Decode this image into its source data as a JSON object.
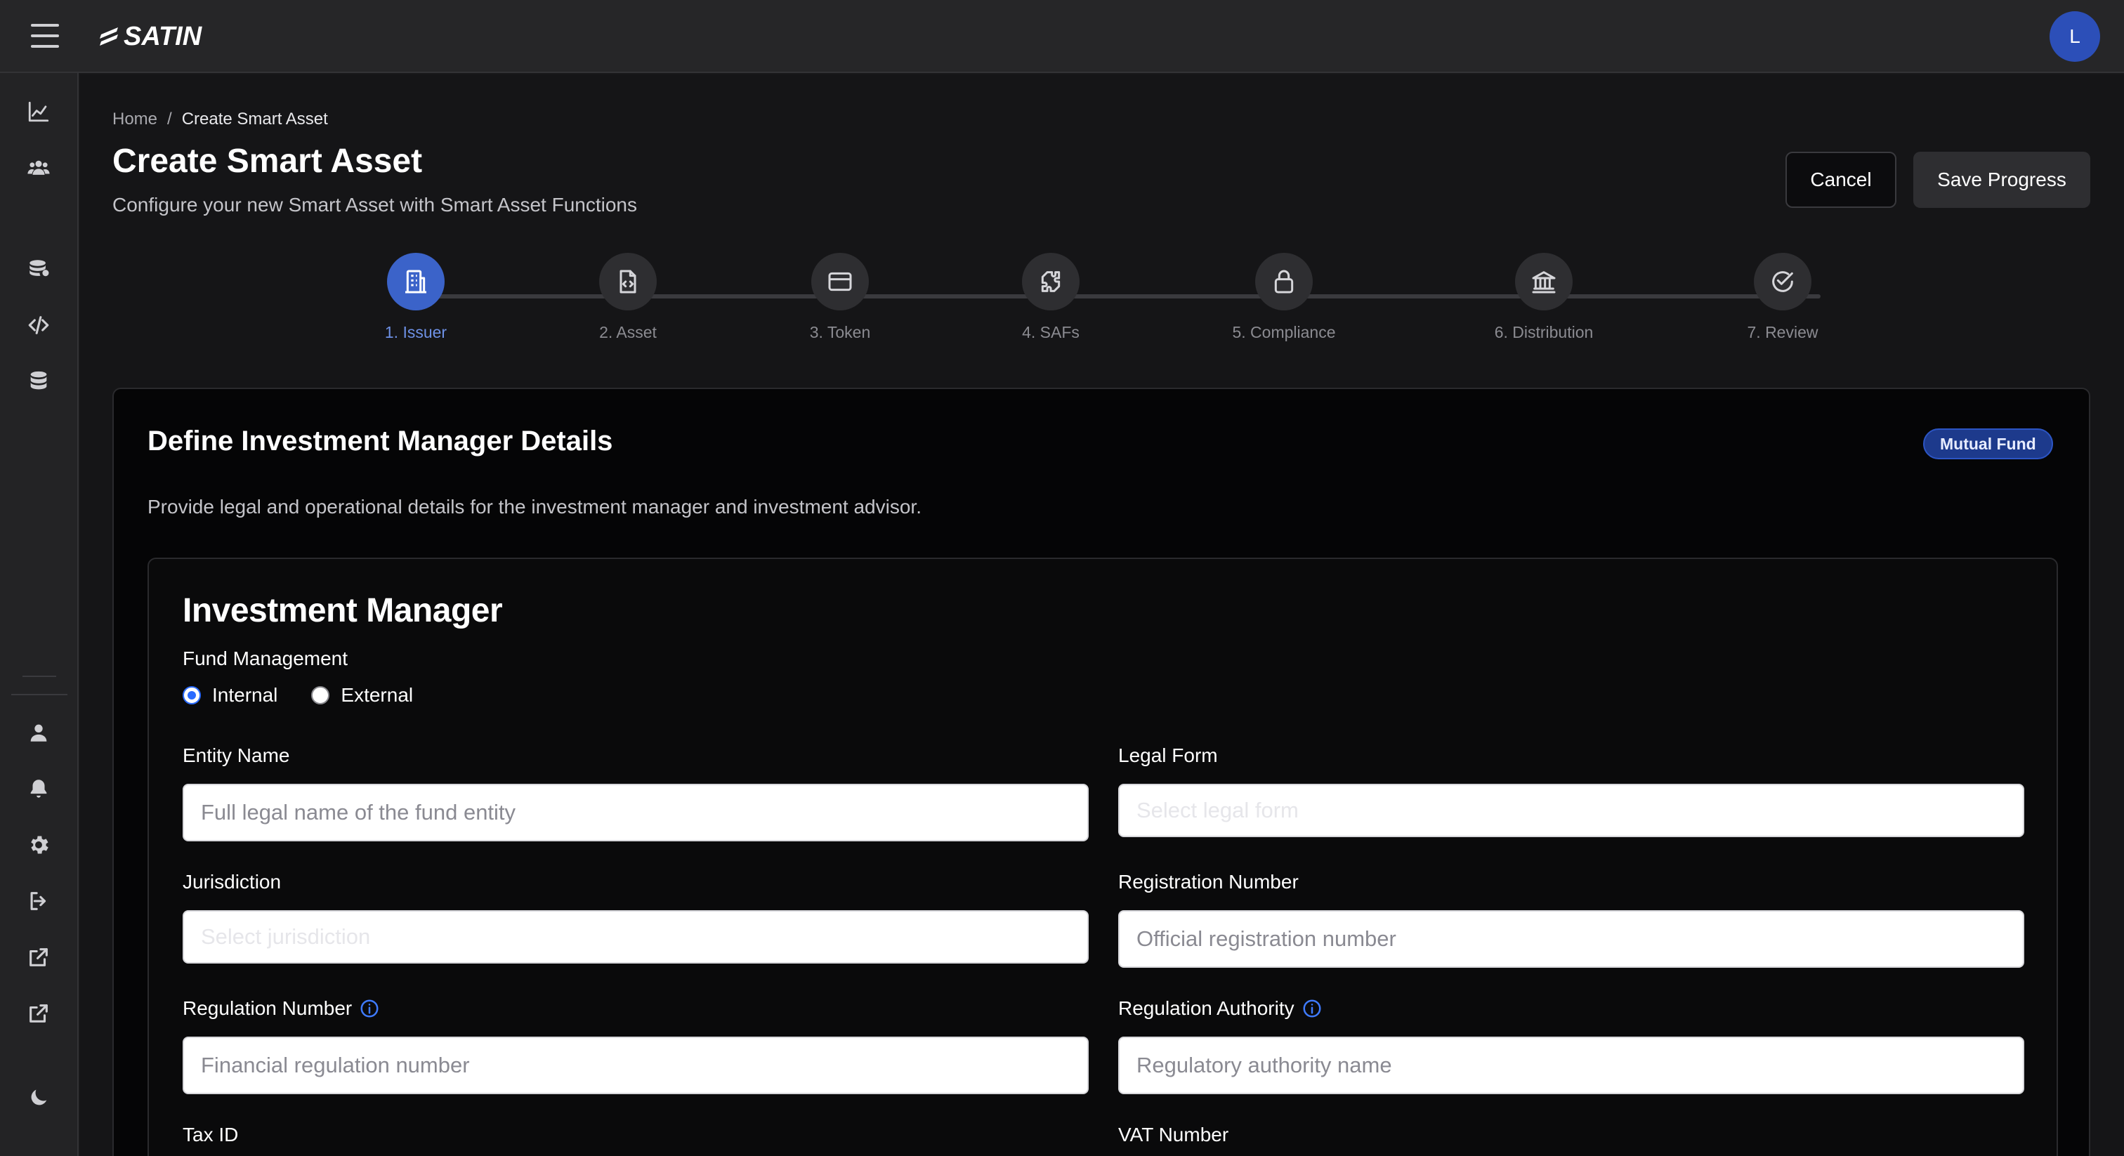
{
  "app": {
    "logo_text": "SATIN",
    "avatar_initial": "L",
    "accent_color": "#3b63c9"
  },
  "sidebar": {
    "items": [
      {
        "name": "analytics-icon"
      },
      {
        "name": "users-icon"
      },
      {
        "name": "assets-stack-icon"
      },
      {
        "name": "code-icon"
      },
      {
        "name": "database-icon"
      },
      {
        "name": "profile-icon"
      },
      {
        "name": "bell-icon"
      },
      {
        "name": "gear-icon"
      },
      {
        "name": "logout-icon"
      },
      {
        "name": "external-link-icon"
      },
      {
        "name": "external-link-icon"
      },
      {
        "name": "moon-icon"
      }
    ]
  },
  "breadcrumb": {
    "home": "Home",
    "separator": "/",
    "current": "Create Smart Asset"
  },
  "header": {
    "title": "Create Smart Asset",
    "subtitle": "Configure your new Smart Asset with Smart Asset Functions",
    "cancel_label": "Cancel",
    "save_label": "Save Progress"
  },
  "stepper": {
    "steps": [
      {
        "label": "1. Issuer",
        "icon": "building-icon",
        "active": true
      },
      {
        "label": "2. Asset",
        "icon": "file-code-icon",
        "active": false
      },
      {
        "label": "3. Token",
        "icon": "card-icon",
        "active": false
      },
      {
        "label": "4. SAFs",
        "icon": "puzzle-icon",
        "active": false
      },
      {
        "label": "5. Compliance",
        "icon": "lock-icon",
        "active": false
      },
      {
        "label": "6. Distribution",
        "icon": "bank-icon",
        "active": false
      },
      {
        "label": "7. Review",
        "icon": "check-circle-icon",
        "active": false
      }
    ]
  },
  "card": {
    "title": "Define Investment Manager Details",
    "badge": "Mutual Fund",
    "description": "Provide legal and operational details for the investment manager and investment advisor."
  },
  "form": {
    "section_title": "Investment Manager",
    "fund_management_label": "Fund Management",
    "options": [
      {
        "label": "Internal",
        "checked": true
      },
      {
        "label": "External",
        "checked": false
      }
    ],
    "entity_name": {
      "label": "Entity Name",
      "placeholder": "Full legal name of the fund entity"
    },
    "legal_form": {
      "label": "Legal Form",
      "placeholder": "Select legal form"
    },
    "jurisdiction": {
      "label": "Jurisdiction",
      "placeholder": "Select jurisdiction"
    },
    "registration_number": {
      "label": "Registration Number",
      "placeholder": "Official registration number"
    },
    "regulation_number": {
      "label": "Regulation Number",
      "placeholder": "Financial regulation number"
    },
    "regulation_authority": {
      "label": "Regulation Authority",
      "placeholder": "Regulatory authority name"
    },
    "tax_id": {
      "label": "Tax ID"
    },
    "vat_number": {
      "label": "VAT Number"
    }
  }
}
